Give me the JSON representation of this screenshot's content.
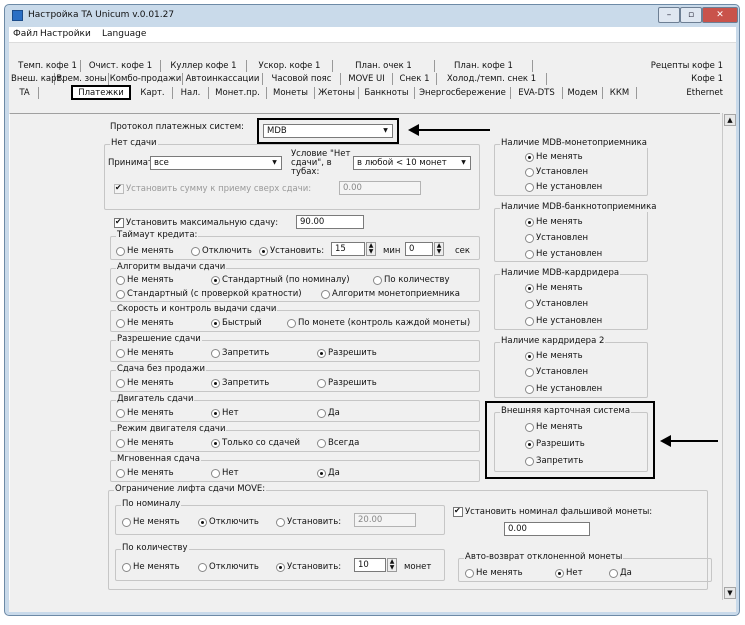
{
  "window": {
    "title": "Настройка TA Unicum v.0.01.27"
  },
  "menu": {
    "file": "Файл",
    "settings": "Настройки",
    "language": "Language"
  },
  "tabs": {
    "row1": [
      "Темп. кофе 1",
      "Очист. кофе 1",
      "Куллер кофе 1",
      "Ускор. кофе 1",
      "План. очек 1",
      "План. кофе 1",
      "Рецепты кофе 1"
    ],
    "row2": [
      "Внеш. карт.",
      "Врем. зоны",
      "Комбо-продажи",
      "Автоинкассации",
      "Часовой пояс",
      "MOVE UI",
      "Снек 1",
      "Холод./темп. снек 1",
      "Кофе 1"
    ],
    "row3": [
      "TA",
      "Платежки",
      "Карт.",
      "Нал.",
      "Монет.пр.",
      "Монеты",
      "Жетоны",
      "Банкноты",
      "Энергосбережение",
      "EVA-DTS",
      "Модем",
      "ККМ",
      "Ethernet"
    ]
  },
  "protocol": {
    "label": "Протокол платежных систем:",
    "value": "MDB"
  },
  "no_change": {
    "title": "Нет сдачи",
    "accept_label": "Принимать:",
    "accept_value": "все",
    "condition_label": "Условие \"Нет сдачи\", в тубах:",
    "condition_value": "в любой < 10 монет",
    "set_sum_label": "Установить сумму к приему сверх сдачи:",
    "set_sum_value": "0.00"
  },
  "max_change": {
    "label": "Установить максимальную сдачу:",
    "value": "90.00"
  },
  "credit_timeout": {
    "title": "Таймаут кредита:",
    "opt_keep": "Не менять",
    "opt_off": "Отключить",
    "opt_set": "Установить:",
    "min_value": "15",
    "min_unit": "мин",
    "sec_value": "0",
    "sec_unit": "сек"
  },
  "algo": {
    "title": "Алгоритм выдачи сдачи",
    "opt_keep": "Не менять",
    "opt_std": "Стандартный (по номиналу)",
    "opt_qty": "По количеству",
    "opt_std_check": "Стандартный (с проверкой кратности)",
    "opt_coin": "Алгоритм монетоприемника"
  },
  "speed": {
    "title": "Скорость и контроль выдачи сдачи",
    "opt_keep": "Не менять",
    "opt_fast": "Быстрый",
    "opt_coin": "По монете (контроль каждой монеты)"
  },
  "allow_change": {
    "title": "Разрешение сдачи",
    "opt_keep": "Не менять",
    "opt_forbid": "Запретить",
    "opt_allow": "Разрешить"
  },
  "no_sale_change": {
    "title": "Сдача без продажи",
    "opt_keep": "Не менять",
    "opt_forbid": "Запретить",
    "opt_allow": "Разрешить"
  },
  "engine": {
    "title": "Двигатель сдачи",
    "opt_keep": "Не менять",
    "opt_no": "Нет",
    "opt_yes": "Да"
  },
  "engine_mode": {
    "title": "Режим двигателя сдачи",
    "opt_keep": "Не менять",
    "opt_only": "Только со сдачей",
    "opt_always": "Всегда"
  },
  "instant": {
    "title": "Мгновенная сдача",
    "opt_keep": "Не менять",
    "opt_no": "Нет",
    "opt_yes": "Да"
  },
  "move_limit": {
    "title": "Ограничение лифта сдачи MOVE:",
    "by_nominal": "По номиналу",
    "nom_value": "20.00",
    "by_qty": "По количеству",
    "qty_value": "10",
    "qty_unit": "монет",
    "opt_keep": "Не менять",
    "opt_off": "Отключить",
    "opt_set": "Установить:"
  },
  "fake_coin": {
    "label": "Установить номинал фальшивой монеты:",
    "value": "0.00"
  },
  "auto_return": {
    "title": "Авто-возврат отклоненной монеты",
    "opt_keep": "Не менять",
    "opt_no": "Нет",
    "opt_yes": "Да"
  },
  "mdb_coin": {
    "title": "Наличие MDB-монетоприемника",
    "opt_keep": "Не менять",
    "opt_set": "Установлен",
    "opt_unset": "Не установлен"
  },
  "mdb_bill": {
    "title": "Наличие MDB-банкнотоприемника",
    "opt_keep": "Не менять",
    "opt_set": "Установлен",
    "opt_unset": "Не установлен"
  },
  "mdb_card": {
    "title": "Наличие MDB-кардридера",
    "opt_keep": "Не менять",
    "opt_set": "Установлен",
    "opt_unset": "Не установлен"
  },
  "card2": {
    "title": "Наличие кардридера 2",
    "opt_keep": "Не менять",
    "opt_set": "Установлен",
    "opt_unset": "Не установлен"
  },
  "ext_card": {
    "title": "Внешняя карточная система",
    "opt_keep": "Не менять",
    "opt_allow": "Разрешить",
    "opt_forbid": "Запретить"
  }
}
